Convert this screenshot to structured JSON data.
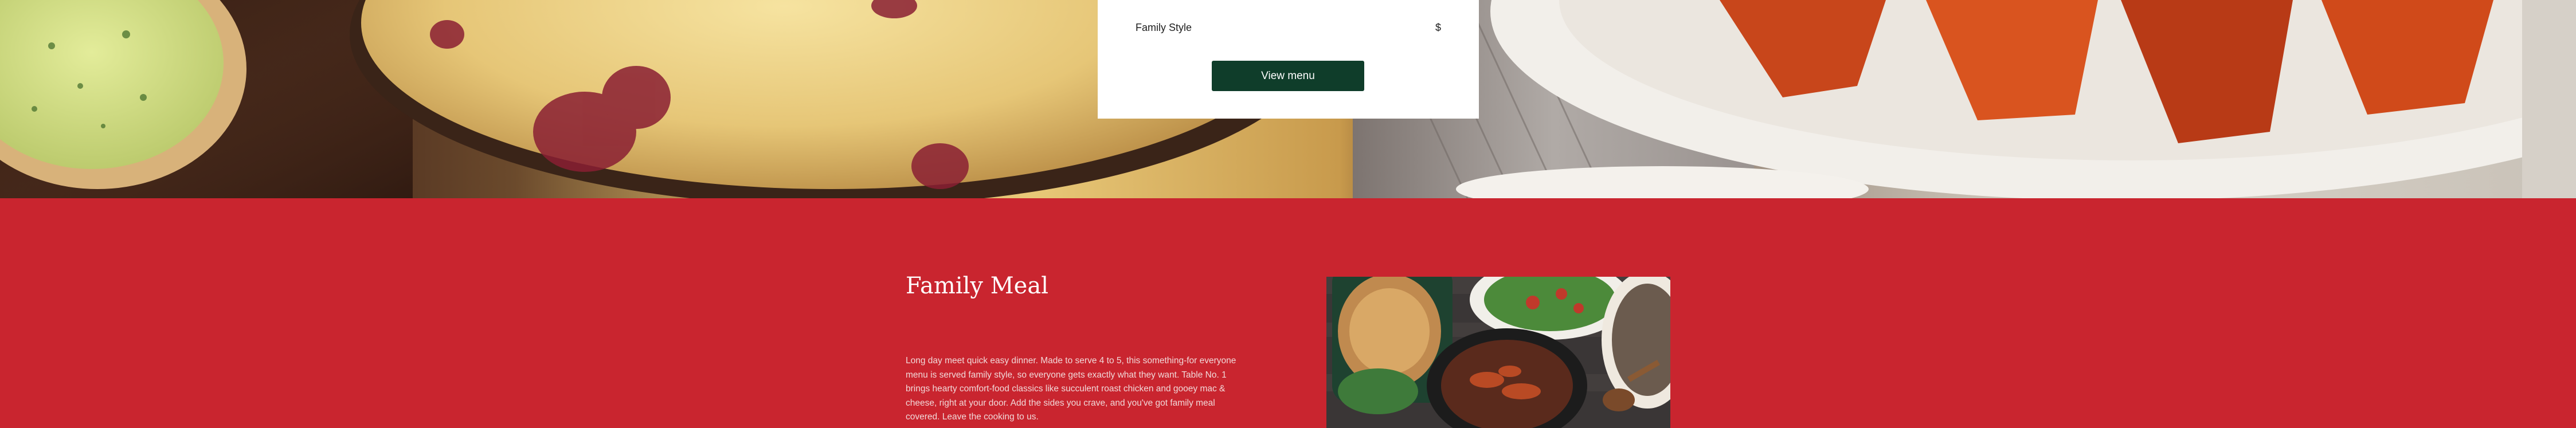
{
  "menu_card": {
    "item_name": "Family Style",
    "item_price": "$",
    "button_label": "View menu"
  },
  "family_meal": {
    "title": "Family Meal",
    "description": "Long day meet quick easy dinner. Made to serve 4 to 5, this something-for everyone menu is served family style, so everyone gets exactly what they want. Table No. 1 brings hearty comfort-food classics like succulent roast chicken and gooey mac & cheese, right at your door. Add the sides you crave, and you've got family meal covered. Leave the cooking to us."
  },
  "colors": {
    "section_background": "#c9252f",
    "button_background": "#0f3d2a",
    "card_background": "#ffffff"
  },
  "images": {
    "hero_photo": "food-photo-mashed-potatoes-and-roasted-carrots",
    "family_meal_photo": "food-photo-family-meal-spread"
  }
}
